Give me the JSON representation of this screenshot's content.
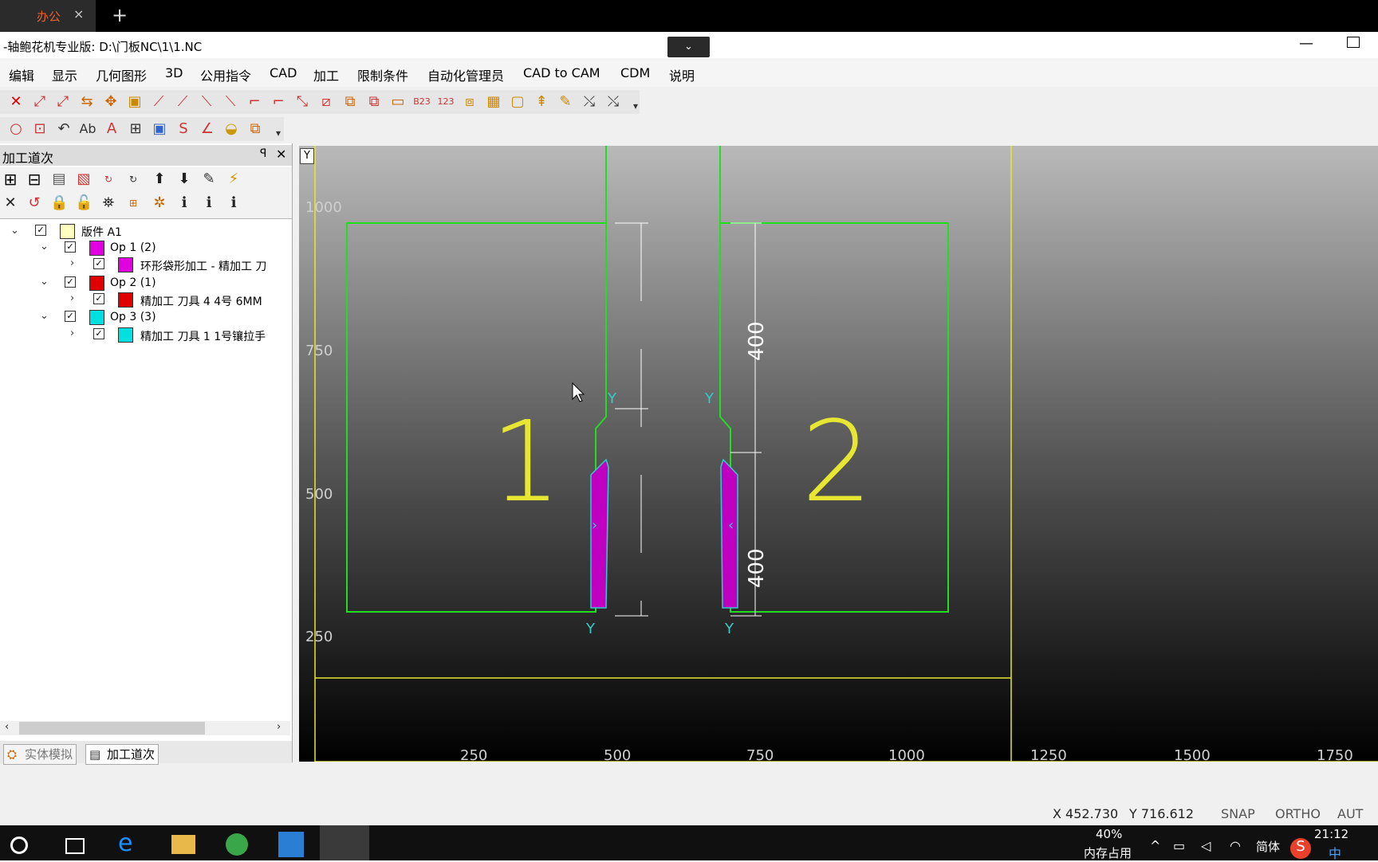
{
  "browser_tab": {
    "label": "办公",
    "close": "×",
    "new_tab": "+"
  },
  "window": {
    "title": "-轴鲍花机专业版: D:\\门板NC\\1\\1.NC",
    "dropdown": "⌄",
    "minimize": "—"
  },
  "menu": [
    "编辑",
    "显示",
    "几何图形",
    "3D",
    "公用指令",
    "CAD",
    "加工",
    "限制条件",
    "自动化管理员",
    "CAD to CAM",
    "CDM",
    "说明"
  ],
  "panel": {
    "title": "加工道次",
    "pin": "ꟼ",
    "close": "✕",
    "tree": [
      {
        "text": "版件 A1",
        "color": "#ffffc0"
      },
      {
        "text": "Op 1  (2)",
        "color": "#e000e0"
      },
      {
        "text": "环形袋形加工 - 精加工  刀",
        "color": "#e000e0"
      },
      {
        "text": "Op 2  (1)",
        "color": "#e00000"
      },
      {
        "text": "精加工   刀具 4   4号 6MM",
        "color": "#e00000"
      },
      {
        "text": "Op 3  (3)",
        "color": "#00e0e0"
      },
      {
        "text": "精加工   刀具 1   1号镶拉手",
        "color": "#00e0e0"
      }
    ],
    "bottom_tabs": [
      "实体模拟",
      "加工道次"
    ]
  },
  "canvas": {
    "y_axis_label": "Y",
    "y_ticks": [
      "1000",
      "750",
      "500",
      "250"
    ],
    "x_ticks": [
      "250",
      "500",
      "750",
      "1000",
      "1250",
      "1500",
      "1750"
    ],
    "part_labels": [
      "1",
      "2"
    ],
    "dimensions": [
      "400",
      "400"
    ],
    "colors": {
      "outline": "#22dd22",
      "label": "#e6e633",
      "toolpath": "#c000c0",
      "dimension": "#ffffff",
      "tool": "#33cccc"
    }
  },
  "status": {
    "x": "X 452.730",
    "y": "Y 716.612",
    "snap": "SNAP",
    "ortho": "ORTHO",
    "auto": "AUT"
  },
  "taskbar": {
    "memory_pct": "40%",
    "memory_label": "内存占用",
    "ime": "简体",
    "time": "21:12",
    "ime_lang": "中"
  }
}
